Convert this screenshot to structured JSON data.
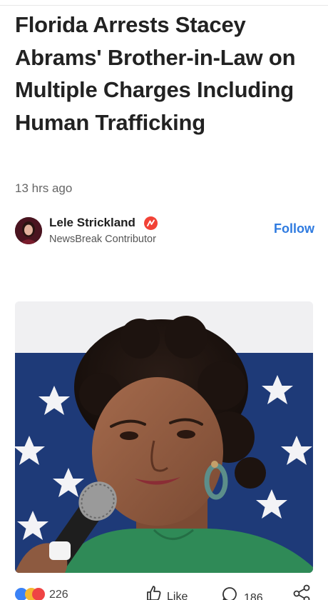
{
  "article": {
    "headline": "Florida Arrests Stacey Abrams' Brother-in-Law on Multiple Charges Including Human Trafficking",
    "timestamp": "13 hrs ago"
  },
  "author": {
    "name": "Lele Strickland",
    "role": "NewsBreak Contributor",
    "badge_icon": "newsbreak-verified-icon",
    "follow_label": "Follow"
  },
  "photo": {
    "icon": "article-photo"
  },
  "actions": {
    "reaction_count": "226",
    "like_label": "Like",
    "comment_count": "186",
    "share_icon": "share-icon"
  },
  "colors": {
    "accent": "#2f7be0",
    "badge": "#f24236",
    "flag_blue": "#1e3a78"
  }
}
